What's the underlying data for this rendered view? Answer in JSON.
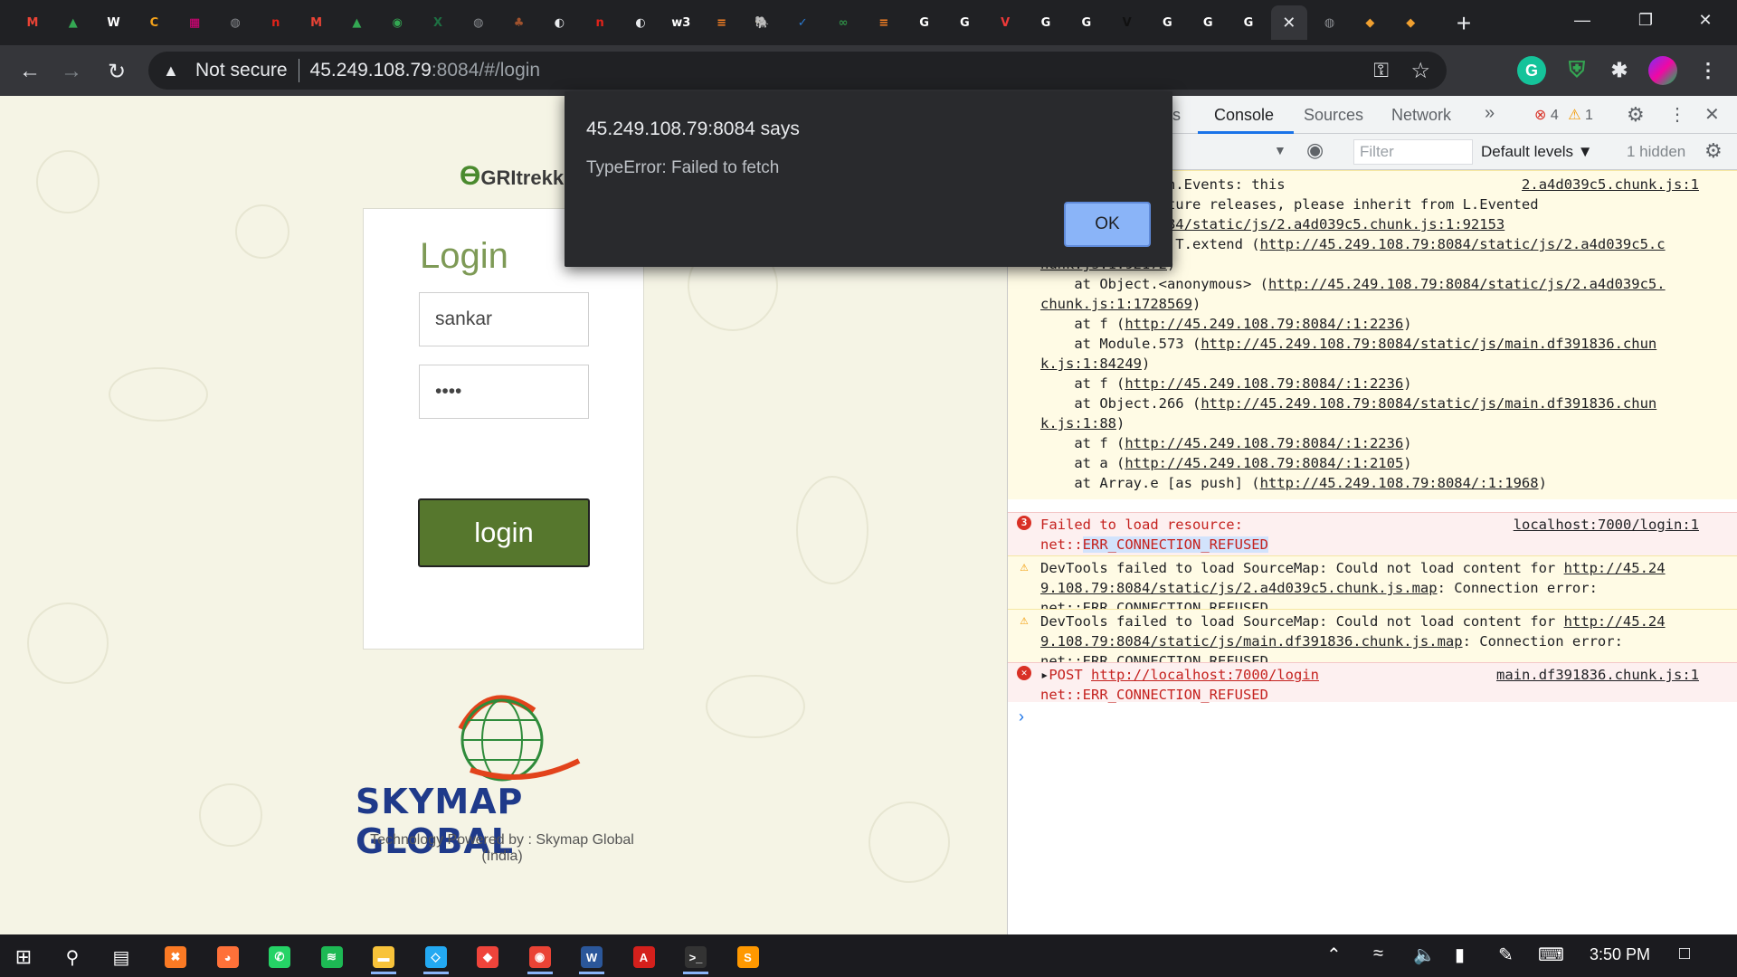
{
  "browser": {
    "tabs": [
      {
        "icon": "gmail-icon",
        "glyph": "M",
        "color": "#ea4335"
      },
      {
        "icon": "drive-icon",
        "glyph": "▲",
        "color": "#34a853"
      },
      {
        "icon": "wikipedia-icon",
        "glyph": "W",
        "color": "#ffffff"
      },
      {
        "icon": "c-icon",
        "glyph": "C",
        "color": "#f4a21a"
      },
      {
        "icon": "grid-icon",
        "glyph": "▦",
        "color": "#e6007e"
      },
      {
        "icon": "globe-icon",
        "glyph": "◍",
        "color": "#8a8d91"
      },
      {
        "icon": "n-icon",
        "glyph": "n",
        "color": "#e2231a"
      },
      {
        "icon": "gmail-icon",
        "glyph": "M",
        "color": "#ea4335"
      },
      {
        "icon": "drive-icon",
        "glyph": "▲",
        "color": "#34a853"
      },
      {
        "icon": "maps-icon",
        "glyph": "◉",
        "color": "#34a853"
      },
      {
        "icon": "excel-icon",
        "glyph": "X",
        "color": "#1d6f42"
      },
      {
        "icon": "globe-icon",
        "glyph": "◍",
        "color": "#8a8d91"
      },
      {
        "icon": "tree-icon",
        "glyph": "♣",
        "color": "#a0522d"
      },
      {
        "icon": "github-icon",
        "glyph": "◐",
        "color": "#e8eaed"
      },
      {
        "icon": "n-icon",
        "glyph": "n",
        "color": "#e2231a"
      },
      {
        "icon": "github-icon",
        "glyph": "◐",
        "color": "#e8eaed"
      },
      {
        "icon": "w3r-icon",
        "glyph": "w3",
        "color": "#ffffff"
      },
      {
        "icon": "stackoverflow-icon",
        "glyph": "≡",
        "color": "#f48024"
      },
      {
        "icon": "postgres-icon",
        "glyph": "🐘",
        "color": "#336791"
      },
      {
        "icon": "check-icon",
        "glyph": "✓",
        "color": "#2b7bd3"
      },
      {
        "icon": "gfg-icon",
        "glyph": "∞",
        "color": "#2f8d46"
      },
      {
        "icon": "stackoverflow-icon",
        "glyph": "≡",
        "color": "#f48024"
      },
      {
        "icon": "google-icon",
        "glyph": "G",
        "color": "#ffffff"
      },
      {
        "icon": "google-icon",
        "glyph": "G",
        "color": "#ffffff"
      },
      {
        "icon": "vivaldi-icon",
        "glyph": "V",
        "color": "#ef3939"
      },
      {
        "icon": "google-icon",
        "glyph": "G",
        "color": "#ffffff"
      },
      {
        "icon": "google-icon",
        "glyph": "G",
        "color": "#ffffff"
      },
      {
        "icon": "v-icon",
        "glyph": "V",
        "color": "#111111"
      },
      {
        "icon": "google-icon",
        "glyph": "G",
        "color": "#ffffff"
      },
      {
        "icon": "google-icon",
        "glyph": "G",
        "color": "#ffffff"
      },
      {
        "icon": "google-icon",
        "glyph": "G",
        "color": "#ffffff"
      },
      {
        "icon": "close-icon",
        "glyph": "✕",
        "color": "#35363a",
        "active": true
      },
      {
        "icon": "globe-icon",
        "glyph": "◍",
        "color": "#8a8d91"
      },
      {
        "icon": "bulb-icon",
        "glyph": "◆",
        "color": "#f0a030"
      },
      {
        "icon": "bulb-icon",
        "glyph": "◆",
        "color": "#f0a030"
      }
    ],
    "new_tab": "+",
    "omnibox": {
      "security_label": "Not secure",
      "host": "45.249.108.79",
      "rest": ":8084/#/login"
    }
  },
  "page": {
    "brand_top": "GRItrekk",
    "login": {
      "title": "Login",
      "username": "sankar",
      "password": "••••",
      "button": "login"
    },
    "skymap_name": "SKYMAP GLOBAL",
    "powered_by": "Technology Powered by : Skymap Global (India)"
  },
  "alert": {
    "title": "45.249.108.79:8084 says",
    "message": "TypeError: Failed to fetch",
    "ok": "OK"
  },
  "devtools": {
    "tabs": {
      "partial": "ts",
      "console": "Console",
      "sources": "Sources",
      "network": "Network",
      "more": "»"
    },
    "errors_count": "4",
    "warnings_count": "1",
    "filter_placeholder": "Filter",
    "levels": "Default levels ▼",
    "hidden": "1 hidden",
    "lines": {
      "l1": "clude of L.Mixin.Events: this",
      "l1_src": "2.a4d039c5.chunk.js:1",
      "l2": "e removed in future releases, please inherit from L.Evented",
      "l3": "5.249.108.79:8084/static/js/2.a4d039c5.chunk.js:1:92153",
      "l4a": "    at Function.T.extend (",
      "l4b": "http://45.249.108.79:8084/static/js/2.a4d039c5.c",
      "l5": "hunk.js:1:92172",
      "l6a": "    at Object.<anonymous> (",
      "l6b": "http://45.249.108.79:8084/static/js/2.a4d039c5.",
      "l7": "chunk.js:1:1728569",
      "l8a": "    at f (",
      "l8b": "http://45.249.108.79:8084/:1:2236",
      "l9a": "    at Module.573 (",
      "l9b": "http://45.249.108.79:8084/static/js/main.df391836.chun",
      "l10": "k.js:1:84249",
      "l11a": "    at f (",
      "l11b": "http://45.249.108.79:8084/:1:2236",
      "l12a": "    at Object.266 (",
      "l12b": "http://45.249.108.79:8084/static/js/main.df391836.chun",
      "l13": "k.js:1:88",
      "l14a": "    at f (",
      "l14b": "http://45.249.108.79:8084/:1:2236",
      "l15a": "    at a (",
      "l15b": "http://45.249.108.79:8084/:1:2105",
      "l16a": "    at Array.e [as push] (",
      "l16b": "http://45.249.108.79:8084/:1:1968"
    },
    "err1": {
      "count": "3",
      "line1": "Failed to load resource:",
      "prefix": "net::",
      "code": "ERR_CONNECTION_REFUSED",
      "src": "localhost:7000/login:1"
    },
    "warn1": {
      "text": "DevTools failed to load SourceMap: Could not load content for ",
      "link1": "http://45.24",
      "link2": "9.108.79:8084/static/js/2.a4d039c5.chunk.js.map",
      "after": ": Connection error:",
      "line3": "net::ERR_CONNECTION_REFUSED"
    },
    "warn2": {
      "text": "DevTools failed to load SourceMap: Could not load content for ",
      "link1": "http://45.24",
      "link2": "9.108.79:8084/static/js/main.df391836.chunk.js.map",
      "after": ": Connection error:",
      "line3": "net::ERR_CONNECTION_REFUSED"
    },
    "err2": {
      "method": "POST ",
      "url": "http://localhost:7000/login",
      "src": "main.df391836.chunk.js:1",
      "line2": "net::ERR_CONNECTION_REFUSED"
    },
    "prompt": "›"
  },
  "taskbar": {
    "clock": "3:50 PM",
    "apps": [
      {
        "icon": "xampp-icon",
        "glyph": "✖",
        "color": "#fb7a24"
      },
      {
        "icon": "firefox-icon",
        "glyph": "◕",
        "color": "#ff7139"
      },
      {
        "icon": "whatsapp-icon",
        "glyph": "✆",
        "color": "#25d366"
      },
      {
        "icon": "spotify-icon",
        "glyph": "≋",
        "color": "#1db954"
      },
      {
        "icon": "folder-icon",
        "glyph": "▬",
        "color": "#f8c33a"
      },
      {
        "icon": "vscode-icon",
        "glyph": "◇",
        "color": "#23a9f2"
      },
      {
        "icon": "anydesk-icon",
        "glyph": "◆",
        "color": "#ef443b"
      },
      {
        "icon": "chrome-icon",
        "glyph": "◉",
        "color": "#ea4335"
      },
      {
        "icon": "word-icon",
        "glyph": "W",
        "color": "#2b579a"
      },
      {
        "icon": "acrobat-icon",
        "glyph": "A",
        "color": "#d4201c"
      },
      {
        "icon": "terminal-icon",
        "glyph": ">_",
        "color": "#333333"
      },
      {
        "icon": "sublime-icon",
        "glyph": "S",
        "color": "#ff9800"
      }
    ]
  }
}
